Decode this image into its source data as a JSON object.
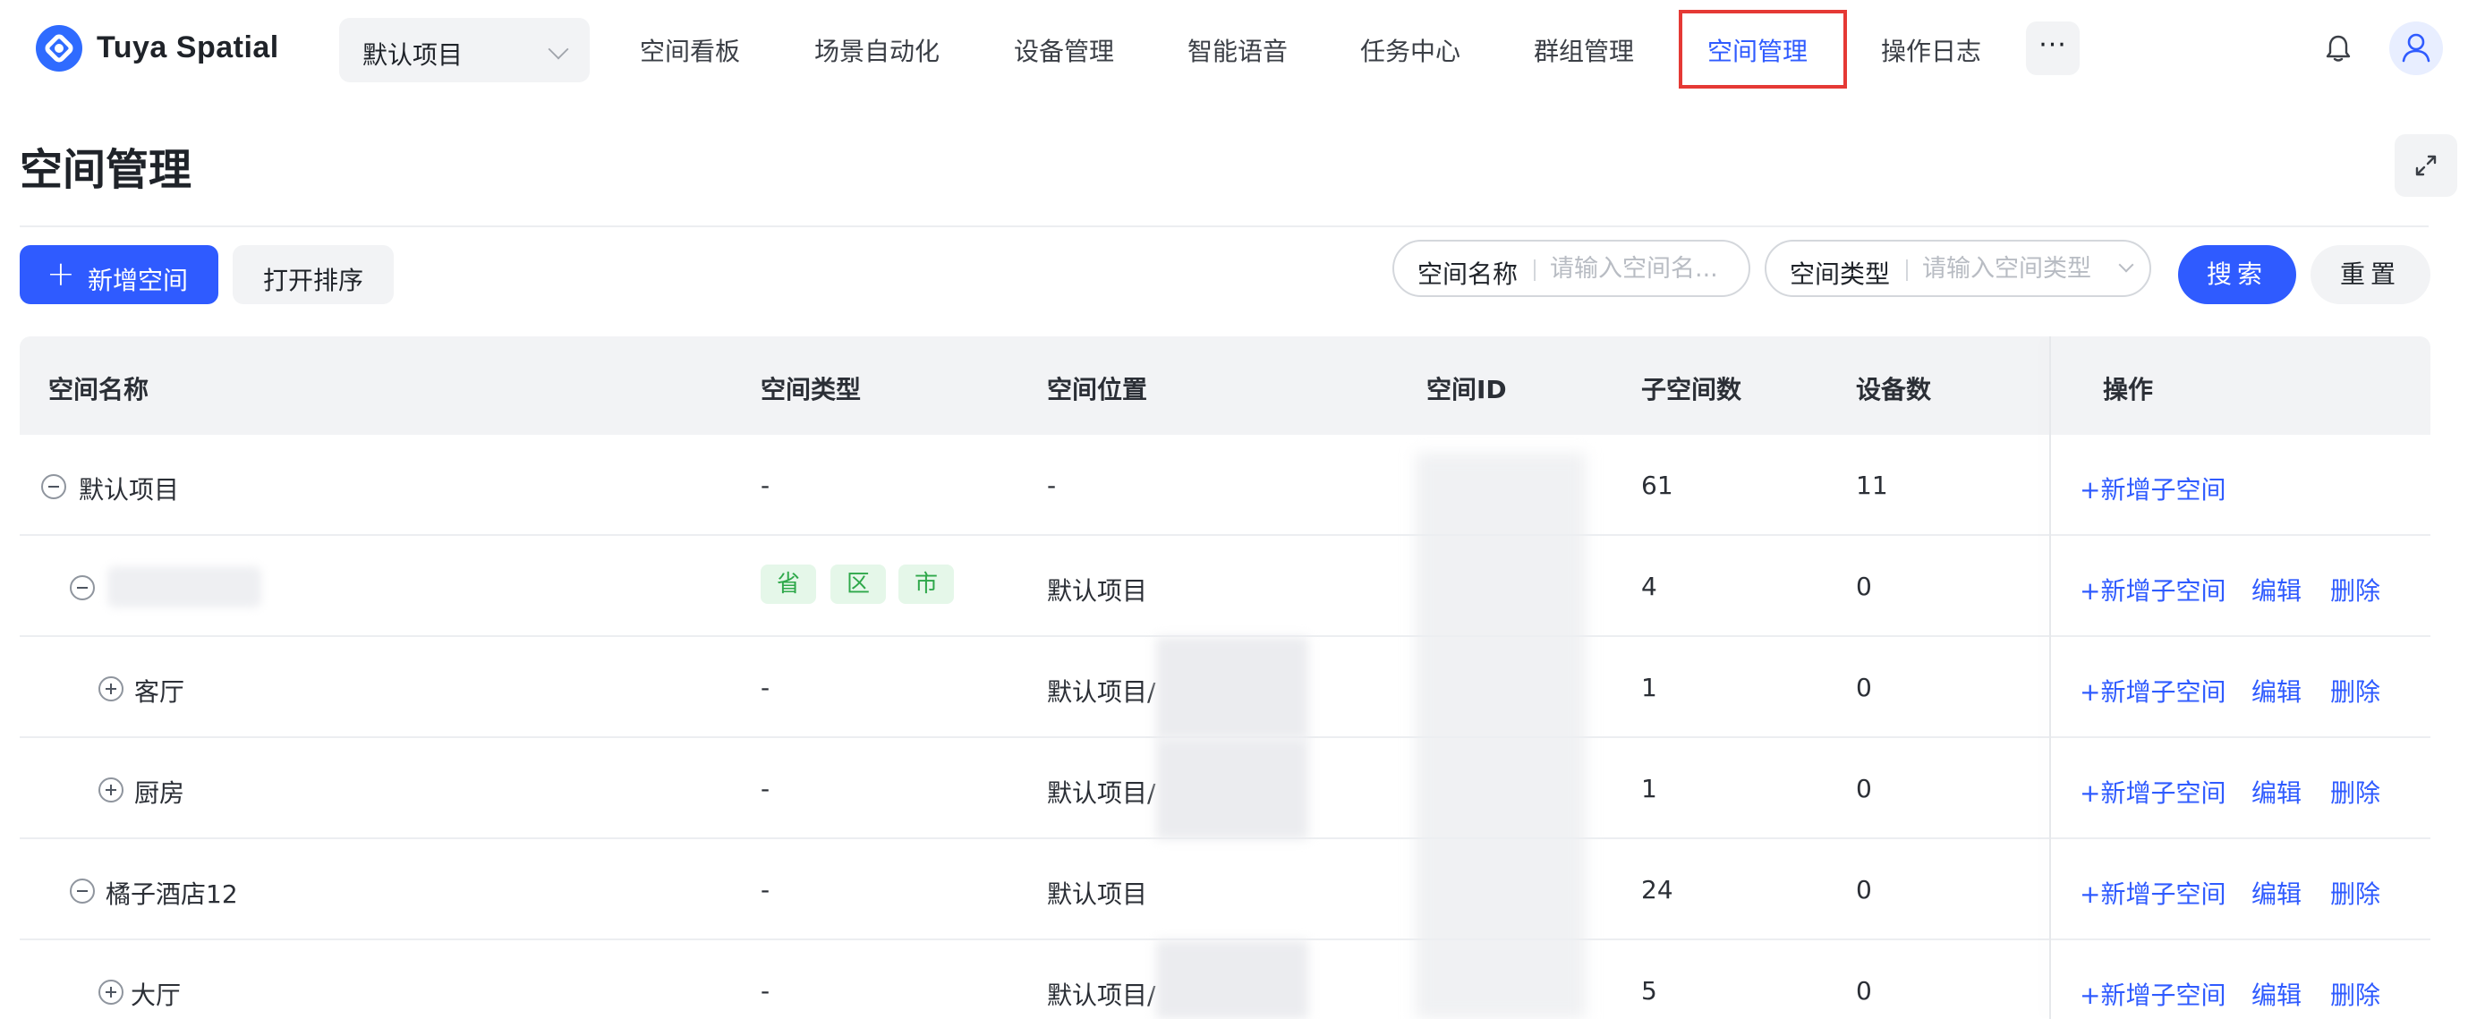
{
  "app": {
    "brand": "Tuya Spatial",
    "project_selector": "默认项目"
  },
  "nav": {
    "items": [
      {
        "label": "空间看板"
      },
      {
        "label": "场景自动化"
      },
      {
        "label": "设备管理"
      },
      {
        "label": "智能语音"
      },
      {
        "label": "任务中心"
      },
      {
        "label": "群组管理"
      },
      {
        "label": "空间管理",
        "active": true
      },
      {
        "label": "操作日志"
      }
    ],
    "more": "···",
    "icons": [
      "bell-icon",
      "avatar-icon"
    ]
  },
  "page": {
    "title": "空间管理"
  },
  "toolbar": {
    "add_space": "新增空间",
    "sort": "打开排序",
    "filter_name_label": "空间名称",
    "filter_name_placeholder": "请输入空间名...",
    "filter_type_label": "空间类型",
    "filter_type_placeholder": "请输入空间类型",
    "search": "搜索",
    "reset": "重置"
  },
  "table": {
    "columns": [
      "空间名称",
      "空间类型",
      "空间位置",
      "空间ID",
      "子空间数",
      "设备数",
      "操作"
    ],
    "rows": [
      {
        "name": "默认项目",
        "type": "-",
        "location": "-",
        "children": "61",
        "devices": "11",
        "actions": [
          "+新增子空间"
        ]
      },
      {
        "name": "",
        "tags": [
          "省",
          "区",
          "市"
        ],
        "location": "默认项目",
        "children": "4",
        "devices": "0",
        "actions": [
          "+新增子空间",
          "编辑",
          "删除"
        ]
      },
      {
        "name": "客厅",
        "type": "-",
        "location": "默认项目/",
        "children": "1",
        "devices": "0",
        "actions": [
          "+新增子空间",
          "编辑",
          "删除"
        ]
      },
      {
        "name": "厨房",
        "type": "-",
        "location": "默认项目/",
        "children": "1",
        "devices": "0",
        "actions": [
          "+新增子空间",
          "编辑",
          "删除"
        ]
      },
      {
        "name": "橘子酒店12",
        "type": "-",
        "location": "默认项目",
        "children": "24",
        "devices": "0",
        "actions": [
          "+新增子空间",
          "编辑",
          "删除"
        ]
      },
      {
        "name": "大厅",
        "type": "-",
        "location": "默认项目/",
        "children": "5",
        "devices": "0",
        "actions": [
          "+新增子空间",
          "编辑",
          "删除"
        ]
      }
    ]
  },
  "colors": {
    "primary": "#2f5bff",
    "highlight_border": "#e53935",
    "tag_bg": "#e5f7e9",
    "tag_text": "#2ea84a"
  }
}
